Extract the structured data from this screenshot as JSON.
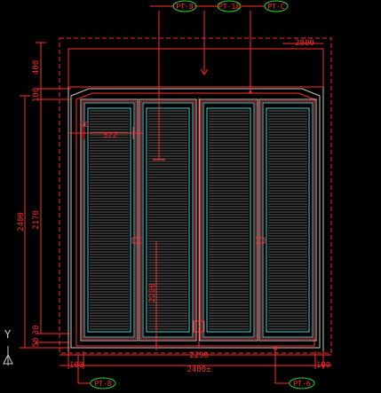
{
  "tags": {
    "top_left": "PT-8",
    "top_mid": "PT-10",
    "top_right": "PT-C",
    "bottom_left": "PT-8",
    "bottom_right": "PT-6"
  },
  "dims": {
    "top_right": "2800",
    "left_400": "400",
    "left_100": "100",
    "left_2400": "2400",
    "left_2170": "2170",
    "left_50": "50",
    "left_30": "30",
    "stile_width": "322",
    "panel_label": "2290",
    "bottom_left_100": "100",
    "bottom_2290": "2290",
    "bottom_2400": "2400±",
    "bottom_right_100": "100"
  },
  "axis": {
    "y_label": "Y"
  },
  "colors": {
    "frame": "#ff2b2b",
    "panel": "#40d8d8",
    "louver": "#c8c8c8",
    "tag_ellipse": "#2bd22b",
    "guide": "#c8c8c8"
  }
}
